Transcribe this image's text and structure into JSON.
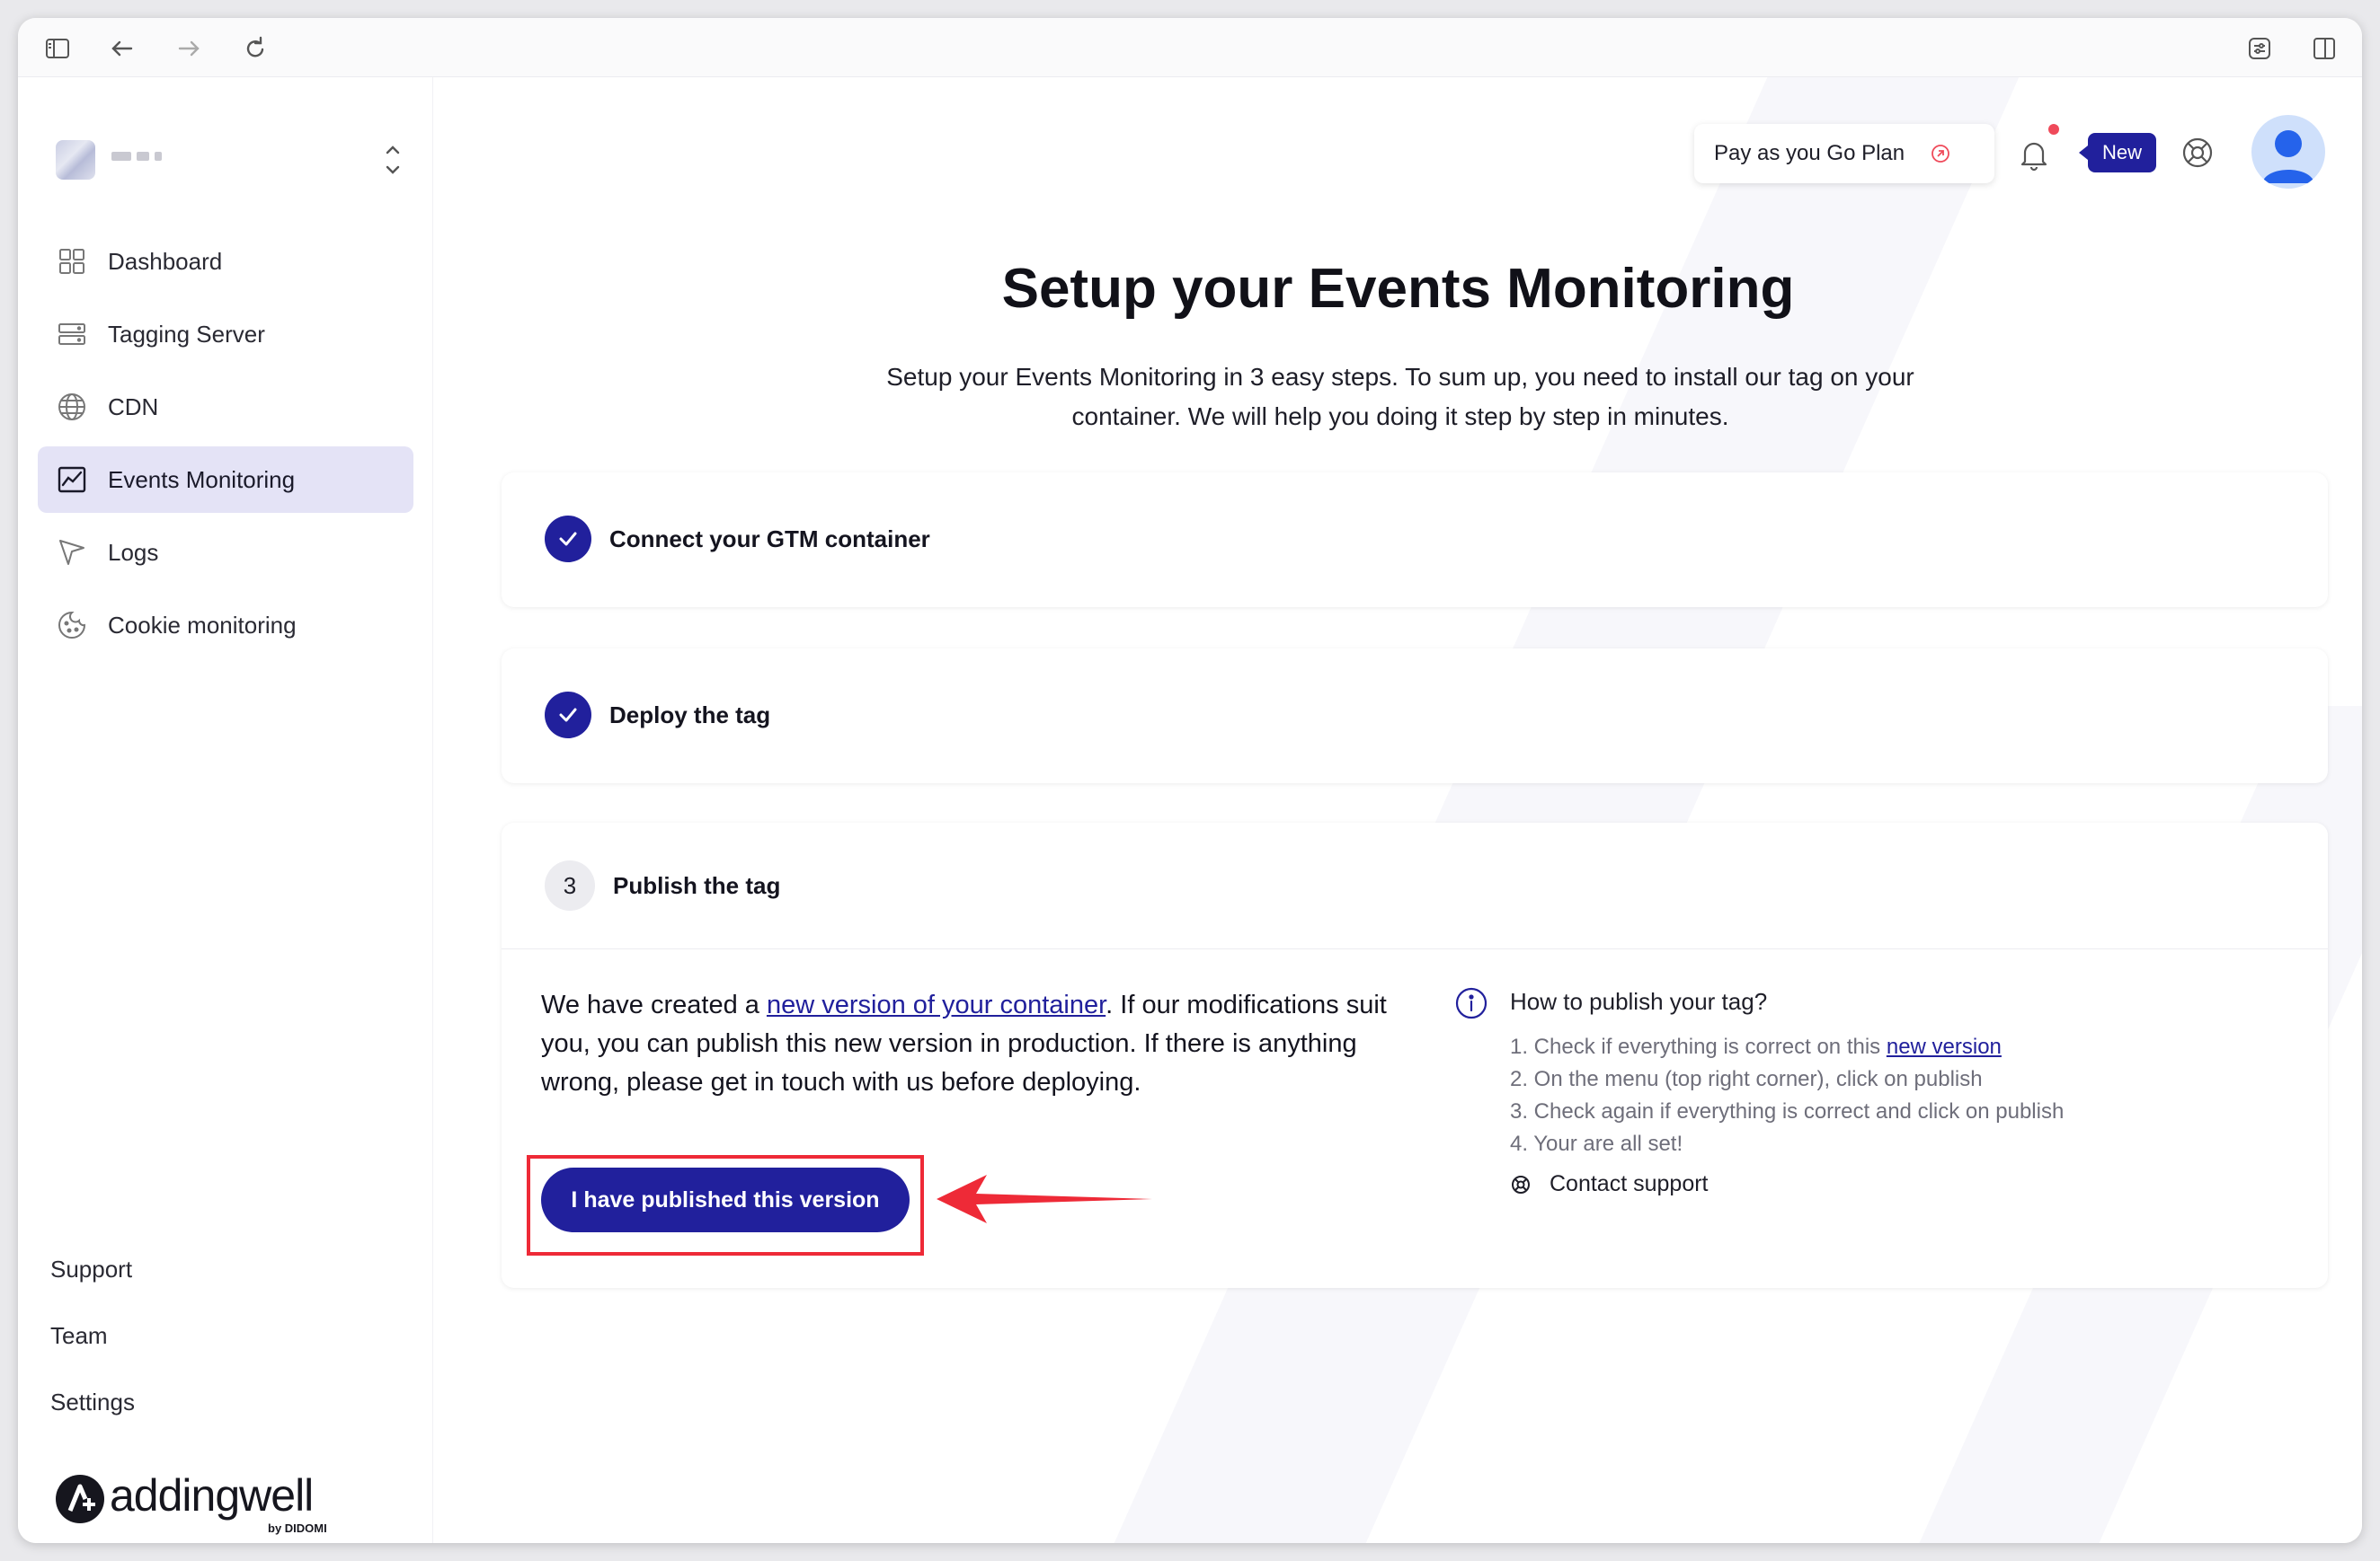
{
  "sidebar": {
    "items": [
      {
        "label": "Dashboard",
        "icon": "grid-icon"
      },
      {
        "label": "Tagging Server",
        "icon": "server-icon"
      },
      {
        "label": "CDN",
        "icon": "globe-icon"
      },
      {
        "label": "Events Monitoring",
        "icon": "chart-icon",
        "active": true
      },
      {
        "label": "Logs",
        "icon": "cursor-icon"
      },
      {
        "label": "Cookie monitoring",
        "icon": "cookie-icon"
      }
    ],
    "footer": {
      "support": "Support",
      "team": "Team",
      "settings": "Settings"
    },
    "brand": {
      "name": "addingwell",
      "by": "by DIDOMI"
    }
  },
  "header": {
    "plan_label": "Pay as you Go Plan",
    "new_badge": "New"
  },
  "page": {
    "title": "Setup your Events Monitoring",
    "subtitle": "Setup your Events Monitoring in 3 easy steps. To sum up, you need to install our tag on your container. We will help you doing it step by step in minutes."
  },
  "steps": [
    {
      "label": "Connect your GTM container",
      "status": "done"
    },
    {
      "label": "Deploy the tag",
      "status": "done"
    },
    {
      "label": "Publish the tag",
      "number": "3",
      "status": "current"
    }
  ],
  "publish": {
    "text_before_link": "We have created a ",
    "link": "new version of your container",
    "text_after_link": ". If our modifications suit you, you can publish this new version in production. If there is anything wrong, please get in touch with us before deploying.",
    "button": "I have published this version"
  },
  "howto": {
    "title": "How to publish your tag?",
    "step1_prefix": "1. Check if everything is correct on this ",
    "step1_link": "new version",
    "step2": "2. On the menu (top right corner), click on publish",
    "step3": "3. Check again if everything is correct and click on publish",
    "step4": "4. Your are all set!",
    "contact": "Contact support"
  },
  "colors": {
    "primary": "#21209c",
    "highlight": "#ee2a37",
    "active_nav": "#e4e3f6"
  }
}
